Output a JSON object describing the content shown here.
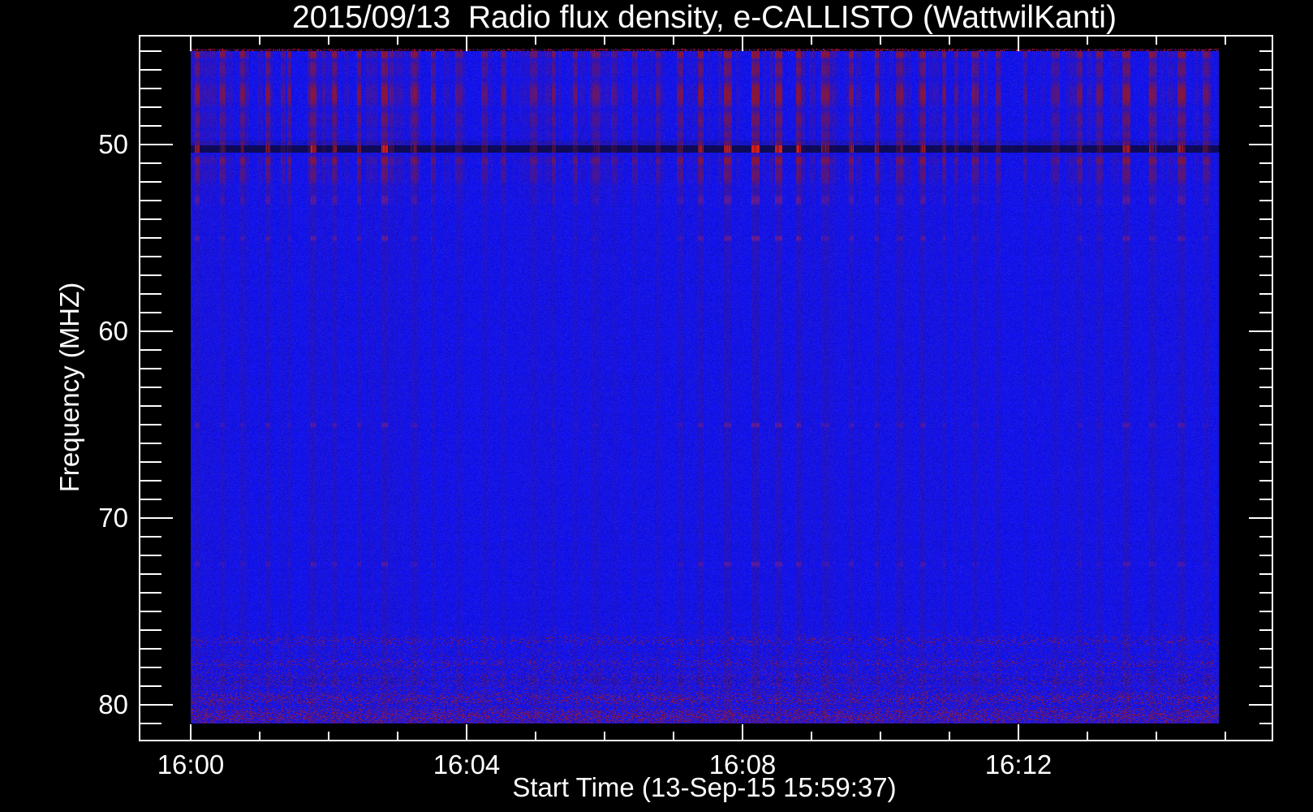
{
  "title": "2015/09/13  Radio flux density, e-CALLISTO (WattwilKanti)",
  "x_axis": {
    "label": "Start Time (13-Sep-15 15:59:37)",
    "tick_labels": [
      "16:00",
      "16:04",
      "16:08",
      "16:12"
    ]
  },
  "y_axis": {
    "label": "Frequency (MHZ)",
    "tick_labels": [
      "50",
      "60",
      "70",
      "80"
    ]
  },
  "colors": {
    "background": "#000000",
    "frame": "#ffffff",
    "text": "#ffffff",
    "base_blue": "#1616ee",
    "stripe_maroon": "#87163e",
    "line_red": "#de1c10",
    "line_navy": "#0a0a50",
    "dot_purple": "#701c8a",
    "speckle_red": "#961a3c"
  },
  "chart_data": {
    "type": "heatmap",
    "title": "2015/09/13  Radio flux density, e-CALLISTO (WattwilKanti)",
    "xlabel": "Start Time (13-Sep-15 15:59:37)",
    "ylabel": "Frequency (MHZ)",
    "instrument": "e-CALLISTO",
    "station": "WattwilKanti",
    "date": "2015/09/13",
    "start_time": "15:59:37",
    "x_major_tick_labels": [
      "16:00",
      "16:04",
      "16:08",
      "16:12"
    ],
    "x_major_tick_minutes": [
      0,
      4,
      8,
      12
    ],
    "x_minor_tick_interval_minutes": 1,
    "x_span_minutes": 15,
    "y_major_ticks_mhz": [
      50,
      60,
      70,
      80
    ],
    "y_minor_tick_interval_mhz": 1,
    "y_range_mhz": [
      45,
      81
    ],
    "y_axis_inverted": true,
    "legend": "none",
    "grid": "off",
    "description": "Quiet-Sun dynamic radio spectrum: uniform blue background flux with periodic vertical RFI stripes between 45 and 56 MHz, a strong red interference line near 50.2 MHz sitting on a dark navy band, faint dotted interference lines near 53, 55, 65 and 72.5 MHz, and speckled red/dark noise bands between 76 and 81 MHz.",
    "interference_bands_mhz": [
      {
        "freq": 45.15,
        "half_width": 0.28,
        "mode": "stripe",
        "weight": 0.8
      },
      {
        "freq": 45.95,
        "half_width": 0.55,
        "mode": "stripe",
        "weight": 0.42
      },
      {
        "freq": 47.3,
        "half_width": 0.8,
        "mode": "stripe",
        "weight": 0.68
      },
      {
        "freq": 48.65,
        "half_width": 0.55,
        "mode": "stripe",
        "weight": 0.4
      },
      {
        "freq": 49.45,
        "half_width": 0.3,
        "mode": "stripe",
        "weight": 0.3
      },
      {
        "freq": 49.9,
        "half_width": 0.18,
        "mode": "stripe-dark",
        "weight": 0.5
      },
      {
        "freq": 50.22,
        "half_width": 0.2,
        "mode": "line",
        "weight": 1.0
      },
      {
        "freq": 50.85,
        "half_width": 0.3,
        "mode": "stripe",
        "weight": 0.62
      },
      {
        "freq": 51.6,
        "half_width": 0.6,
        "mode": "stripe",
        "weight": 0.34
      },
      {
        "freq": 52.95,
        "half_width": 0.3,
        "mode": "dot",
        "weight": 0.34
      },
      {
        "freq": 55.0,
        "half_width": 0.18,
        "mode": "dot",
        "weight": 0.4
      },
      {
        "freq": 65.0,
        "half_width": 0.17,
        "mode": "dot",
        "weight": 0.34
      },
      {
        "freq": 72.45,
        "half_width": 0.18,
        "mode": "dot",
        "weight": 0.3
      },
      {
        "freq": 76.55,
        "half_width": 0.3,
        "mode": "speckle",
        "weight": 0.3
      },
      {
        "freq": 77.75,
        "half_width": 0.25,
        "mode": "speckle",
        "weight": 0.25
      },
      {
        "freq": 78.65,
        "half_width": 0.35,
        "mode": "flicker",
        "weight": 0.55
      },
      {
        "freq": 79.65,
        "half_width": 0.35,
        "mode": "speckle",
        "weight": 0.45
      },
      {
        "freq": 80.6,
        "half_width": 0.5,
        "mode": "speckle",
        "weight": 0.62
      }
    ]
  }
}
